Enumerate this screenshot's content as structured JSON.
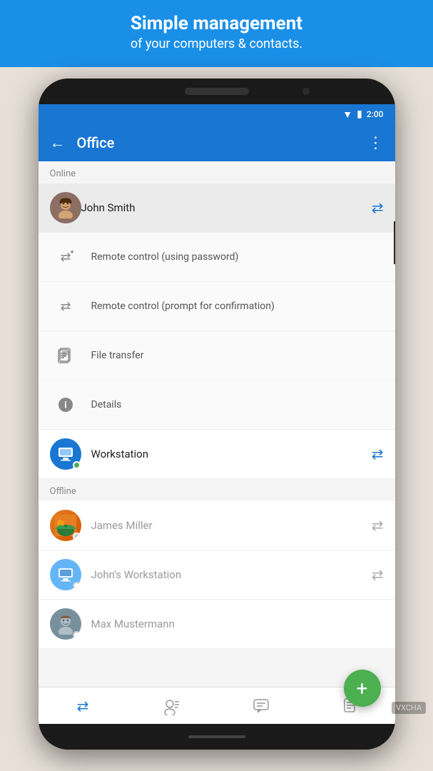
{
  "banner": {
    "main_title": "Simple management",
    "sub_title": "of your computers & contacts."
  },
  "status_bar": {
    "time": "2:00"
  },
  "app_bar": {
    "title": "Office",
    "back_label": "←",
    "more_label": "⋮"
  },
  "sections": [
    {
      "header": "Online",
      "items": [
        {
          "id": "john-smith",
          "name": "John Smith",
          "type": "person",
          "status": "online",
          "has_remote": true,
          "highlighted": true
        },
        {
          "id": "remote-control-password",
          "name": "Remote control (using password)",
          "type": "sub-action",
          "icon": "remote"
        },
        {
          "id": "remote-control-confirm",
          "name": "Remote control (prompt for confirmation)",
          "type": "sub-action",
          "icon": "remote"
        },
        {
          "id": "file-transfer",
          "name": "File transfer",
          "type": "sub-action",
          "icon": "file"
        },
        {
          "id": "details",
          "name": "Details",
          "type": "sub-action",
          "icon": "info"
        },
        {
          "id": "workstation",
          "name": "Workstation",
          "type": "computer",
          "status": "online",
          "has_remote": true,
          "highlighted": false
        }
      ]
    },
    {
      "header": "Offline",
      "items": [
        {
          "id": "james-miller",
          "name": "James Miller",
          "type": "person",
          "status": "offline",
          "has_remote": true
        },
        {
          "id": "johns-workstation",
          "name": "John's Workstation",
          "type": "computer",
          "status": "offline",
          "has_remote": true
        },
        {
          "id": "max-mustermann",
          "name": "Max Mustermann",
          "type": "person",
          "status": "offline",
          "has_remote": false
        }
      ]
    }
  ],
  "fab": {
    "label": "+"
  },
  "bottom_nav": [
    {
      "id": "remote",
      "icon": "⇄",
      "active": true
    },
    {
      "id": "contacts",
      "icon": "👤",
      "active": false
    },
    {
      "id": "chat",
      "icon": "💬",
      "active": false
    },
    {
      "id": "files",
      "icon": "📋",
      "active": false
    }
  ],
  "watermark": "VXCHA"
}
